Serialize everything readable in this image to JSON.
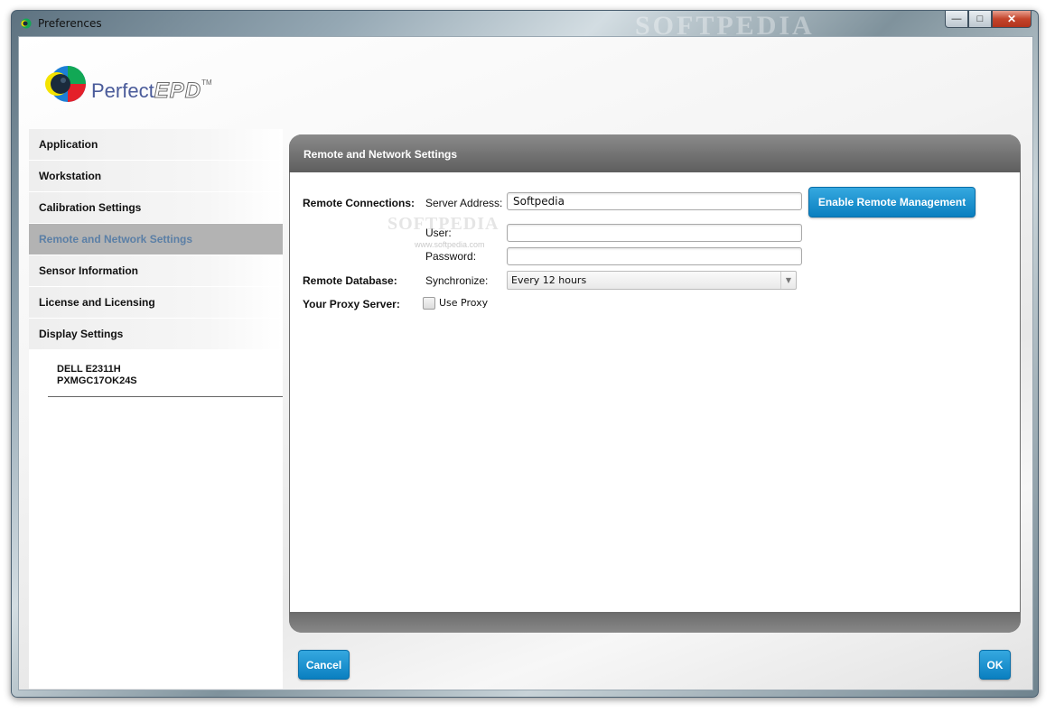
{
  "window": {
    "title": "Preferences",
    "watermark": "SOFTPEDIA",
    "minimize_glyph": "—",
    "maximize_glyph": "□",
    "close_glyph": "✕"
  },
  "logo": {
    "brand_text": "Perfect",
    "brand_strong": "EPD",
    "trademark": "TM",
    "colors": {
      "dark": "#1a2b3c",
      "yellow": "#f4e300",
      "blue": "#1c7fd6",
      "green": "#12a855",
      "red": "#e4202a"
    }
  },
  "sidebar": {
    "items": [
      {
        "label": "Application",
        "active": false
      },
      {
        "label": "Workstation",
        "active": false
      },
      {
        "label": "Calibration Settings",
        "active": false
      },
      {
        "label": "Remote and Network Settings",
        "active": true
      },
      {
        "label": "Sensor Information",
        "active": false
      },
      {
        "label": "License and Licensing",
        "active": false
      },
      {
        "label": "Display Settings",
        "active": false
      }
    ],
    "display": {
      "model": "DELL E2311H",
      "serial": "PXMGC17OK24S"
    }
  },
  "panel": {
    "title": "Remote and Network Settings",
    "remote_connections": {
      "label": "Remote Connections:",
      "server_address_label": "Server Address:",
      "server_address_value": "Softpedia",
      "user_label": "User:",
      "user_value": "",
      "password_label": "Password:",
      "password_value": "",
      "enable_button": "Enable Remote Management"
    },
    "remote_database": {
      "label": "Remote Database:",
      "synchronize_label": "Synchronize:",
      "synchronize_value": "Every 12 hours"
    },
    "proxy": {
      "label": "Your Proxy Server:",
      "use_proxy_label": "Use Proxy",
      "checked": false
    },
    "watermark": "SOFTPEDIA",
    "watermark_url": "www.softpedia.com"
  },
  "footer": {
    "cancel_label": "Cancel",
    "ok_label": "OK"
  },
  "accent_color": "#0a88cc"
}
